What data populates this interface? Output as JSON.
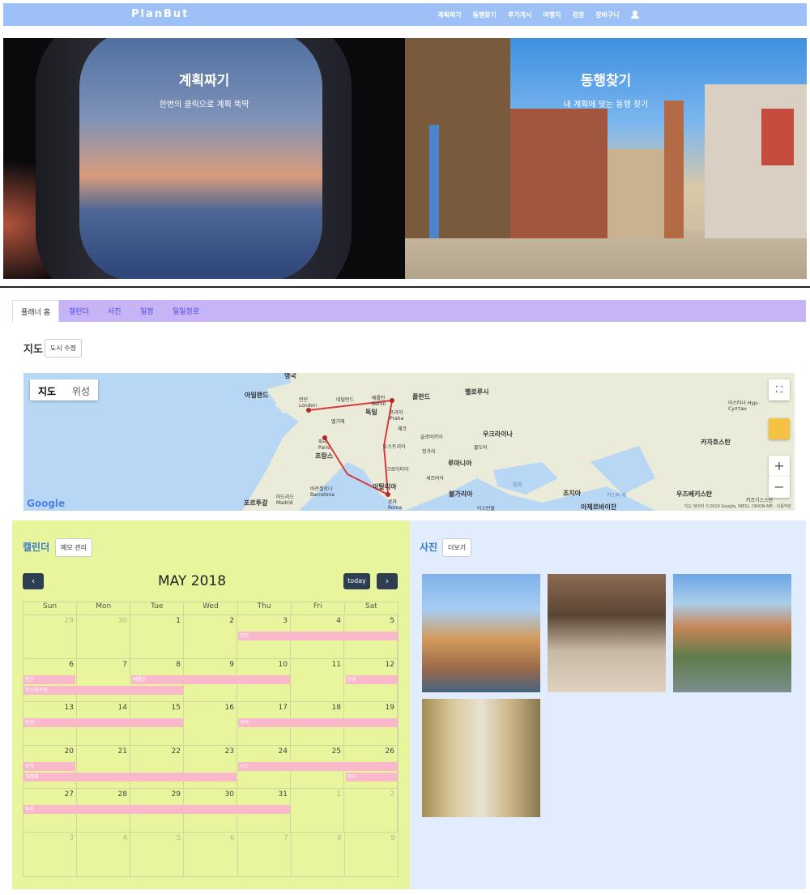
{
  "nav": {
    "brand": "PlanBut",
    "links": [
      "계획짜기",
      "동행찾기",
      "후기게시",
      "여행지",
      "검정",
      "장바구니"
    ]
  },
  "hero": {
    "left": {
      "title": "계획짜기",
      "subtitle": "한번의 클릭으로 계획 뚝딱"
    },
    "right": {
      "title": "동행찾기",
      "subtitle": "내 계획에 맞는 동행 찾기"
    }
  },
  "tabs": [
    "플래너 홈",
    "캘린더",
    "사진",
    "일정",
    "일일정로"
  ],
  "map_section": {
    "title": "지도",
    "edit_button": "도시 수정",
    "map_type": [
      "지도",
      "위성"
    ],
    "labels": [
      "영국",
      "아일랜드",
      "런던 London",
      "네덜란드",
      "베를린 Berlin",
      "폴란드",
      "벨로루시",
      "벨기에",
      "독일",
      "프라하 Praha",
      "체코",
      "우크라이나",
      "파리 Paris",
      "프랑스",
      "오스트리아",
      "슬로바키아",
      "헝가리",
      "몰도바",
      "루마니아",
      "크로아티아",
      "세르비아",
      "이탈리아",
      "불가리아",
      "바르셀로나 Barcelona",
      "마드리드 Madrid",
      "포르투갈",
      "로마 Roma",
      "흑해",
      "조지아",
      "카스피 해",
      "아제르바이잔",
      "카자흐스탄",
      "아스타나 Нур-Султан",
      "우즈베키스탄",
      "키르기스스탄",
      "이스탄불"
    ],
    "google": "Google",
    "attribution": "지도 데이터 ©2019 Google, INEGI, ORION-ME · 이용약관"
  },
  "calendar": {
    "title": "캘린더",
    "memo_button": "메모 관리",
    "month": "MAY 2018",
    "today": "today",
    "prev": "‹",
    "next": "›",
    "weekdays": [
      "Sun",
      "Mon",
      "Tue",
      "Wed",
      "Thu",
      "Fri",
      "Sat"
    ],
    "weeks": [
      [
        "29",
        "30",
        "1",
        "2",
        "3",
        "4",
        "5"
      ],
      [
        "6",
        "7",
        "8",
        "9",
        "10",
        "11",
        "12"
      ],
      [
        "13",
        "14",
        "15",
        "16",
        "17",
        "18",
        "19"
      ],
      [
        "20",
        "21",
        "22",
        "23",
        "24",
        "25",
        "26"
      ],
      [
        "27",
        "28",
        "29",
        "30",
        "31",
        "1",
        "2"
      ],
      [
        "3",
        "4",
        "5",
        "6",
        "7",
        "8",
        "9"
      ]
    ],
    "events": [
      {
        "label": "런던",
        "week": 0,
        "start": 4,
        "span": 3
      },
      {
        "label": "런던",
        "week": 1,
        "start": 0,
        "span": 1
      },
      {
        "label": "베를린",
        "week": 1,
        "start": 2,
        "span": 3
      },
      {
        "label": "빈센",
        "week": 1,
        "start": 6,
        "span": 1
      },
      {
        "label": "암스테르담",
        "week": 1,
        "start": 0,
        "span": 3,
        "row": 1
      },
      {
        "label": "빈센",
        "week": 2,
        "start": 0,
        "span": 3
      },
      {
        "label": "로마",
        "week": 2,
        "start": 4,
        "span": 3
      },
      {
        "label": "로마",
        "week": 3,
        "start": 0,
        "span": 1
      },
      {
        "label": "니스",
        "week": 3,
        "start": 4,
        "span": 3
      },
      {
        "label": "피렌체",
        "week": 3,
        "start": 0,
        "span": 4,
        "row": 1
      },
      {
        "label": "파리",
        "week": 3,
        "start": 6,
        "span": 1,
        "row": 1
      },
      {
        "label": "파리",
        "week": 4,
        "start": 0,
        "span": 5
      }
    ]
  },
  "photos": {
    "title": "사진",
    "more_button": "더보기"
  }
}
